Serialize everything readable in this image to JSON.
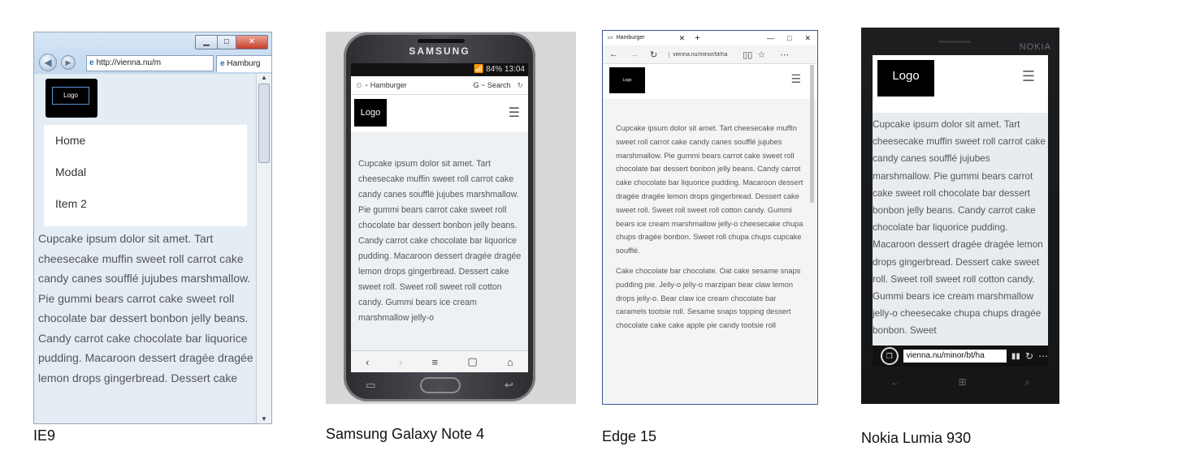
{
  "captions": {
    "ie": "IE9",
    "samsung": "Samsung Galaxy Note 4",
    "edge": "Edge 15",
    "nokia": "Nokia Lumia 930"
  },
  "ie9": {
    "url": "http://vienna.nu/m",
    "tab_label": "Hamburg",
    "logo": "Logo",
    "menu": [
      "Home",
      "Modal",
      "Item 2"
    ],
    "body": "Cupcake ipsum dolor sit amet. Tart cheesecake muffin sweet roll carrot cake candy canes soufflé jujubes marshmallow. Pie gummi bears carrot cake sweet roll chocolate bar dessert bonbon jelly beans. Candy carrot cake chocolate bar liquorice pudding. Macaroon dessert dragée dragée lemon drops gingerbread. Dessert cake"
  },
  "samsung": {
    "brand": "SAMSUNG",
    "status_time": "84% 13:04",
    "tab_title": "Hamburger",
    "search_label": "G ~ Search",
    "logo": "Logo",
    "body": "Cupcake ipsum dolor sit amet. Tart cheesecake muffin sweet roll carrot cake candy canes soufflé jujubes marshmallow. Pie gummi bears carrot cake sweet roll chocolate bar dessert bonbon jelly beans. Candy carrot cake chocolate bar liquorice pudding. Macaroon dessert dragée dragée lemon drops gingerbread. Dessert cake sweet roll. Sweet roll sweet roll cotton candy. Gummi bears ice cream marshmallow jelly-o"
  },
  "edge": {
    "tab_title": "Hamburger",
    "url": "vienna.nu/minor/bt/ha",
    "logo": "Logo",
    "para1": "Cupcake ipsum dolor sit amet. Tart cheesecake muffin sweet roll carrot cake candy canes soufflé jujubes marshmallow. Pie gummi bears carrot cake sweet roll chocolate bar dessert bonbon jelly beans. Candy carrot cake chocolate bar liquorice pudding. Macaroon dessert dragée dragée lemon drops gingerbread. Dessert cake sweet roll. Sweet roll sweet roll cotton candy. Gummi bears ice cream marshmallow jelly-o cheesecake chupa chups dragée bonbon. Sweet roll chupa chups cupcake soufflé.",
    "para2": "Cake chocolate bar chocolate. Oat cake sesame snaps pudding pie. Jelly-o jelly-o marzipan bear claw lemon drops jelly-o. Bear claw ice cream chocolate bar caramels tootsie roll. Sesame snaps topping dessert chocolate cake cake apple pie candy tootsie roll"
  },
  "nokia": {
    "brand": "NOKIA",
    "logo": "Logo",
    "url": "vienna.nu/minor/bt/ha",
    "body": "Cupcake ipsum dolor sit amet. Tart cheesecake muffin sweet roll carrot cake candy canes soufflé jujubes marshmallow. Pie gummi bears carrot cake sweet roll chocolate bar dessert bonbon jelly beans. Candy carrot cake chocolate bar liquorice pudding. Macaroon dessert dragée dragée lemon drops gingerbread. Dessert cake sweet roll. Sweet roll sweet roll cotton candy. Gummi bears ice cream marshmallow jelly-o cheesecake chupa chups dragée bonbon. Sweet"
  }
}
